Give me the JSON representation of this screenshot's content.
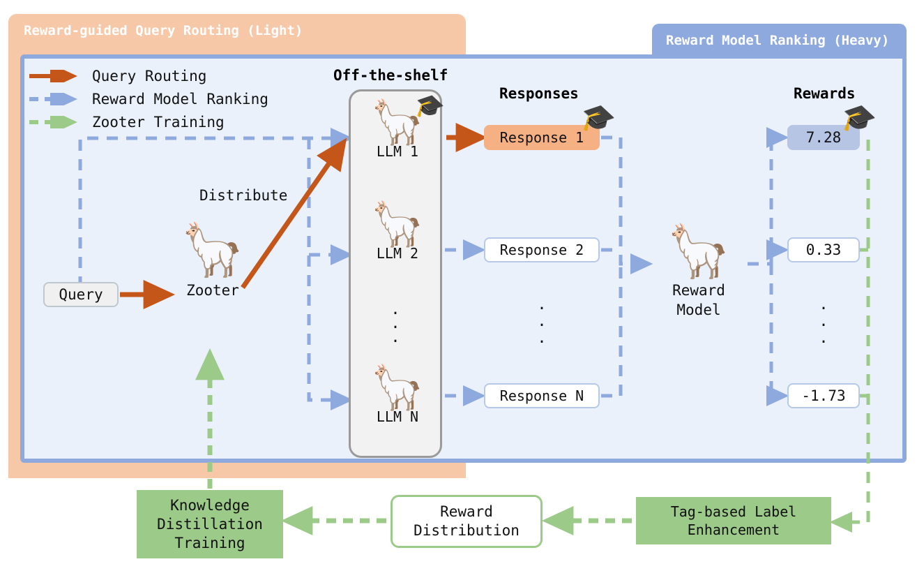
{
  "panels": {
    "left": {
      "title": "Reward-guided Query Routing (Light)",
      "bg": "#F7C8A8"
    },
    "right": {
      "title": "Reward Model Ranking (Heavy)",
      "bg": "#EAF1FB",
      "border": "#8EA9DE"
    }
  },
  "legend": {
    "items": [
      {
        "label": "Query Routing",
        "color": "#C4561A",
        "style": "solid"
      },
      {
        "label": "Reward Model Ranking",
        "color": "#8EA9DE",
        "style": "dashed"
      },
      {
        "label": "Zooter Training",
        "color": "#9CCA88",
        "style": "dashed"
      }
    ]
  },
  "headings": {
    "off_the_shelf": "Off-the-shelf",
    "responses": "Responses",
    "rewards": "Rewards"
  },
  "query": {
    "label": "Query"
  },
  "router": {
    "label": "Zooter",
    "icon": "llama-glasses-icon",
    "edge_label": "Distribute"
  },
  "llms": [
    {
      "label": "LLM 1",
      "icon": "llama-graduate-icon"
    },
    {
      "label": "LLM 2",
      "icon": "llama-icon"
    },
    {
      "label": "LLM N",
      "icon": "llama-icon"
    }
  ],
  "llm_ellipsis": ".\n.\n.",
  "responses": [
    {
      "label": "Response 1",
      "highlighted": true
    },
    {
      "label": "Response 2",
      "highlighted": false
    },
    {
      "label": "Response N",
      "highlighted": false
    }
  ],
  "response_ellipsis": ".\n.\n.",
  "reward_model": {
    "label_line1": "Reward",
    "label_line2": "Model",
    "icon": "llama-reading-icon"
  },
  "rewards": [
    {
      "value": "7.28",
      "highlighted": true
    },
    {
      "value": "0.33",
      "highlighted": false
    },
    {
      "value": "-1.73",
      "highlighted": false
    }
  ],
  "reward_ellipsis": ".\n.\n.",
  "bottom_nodes": {
    "knowledge_distillation": "Knowledge\nDistillation\nTraining",
    "reward_distribution": "Reward\nDistribution",
    "tag_based_label": "Tag-based Label\nEnhancement"
  },
  "colors": {
    "query_routing": "#C4561A",
    "reward_ranking": "#8EA9DE",
    "zooter_training": "#9CCA88",
    "highlight_response": "#F5B183",
    "highlight_reward": "#B6C5E4"
  }
}
